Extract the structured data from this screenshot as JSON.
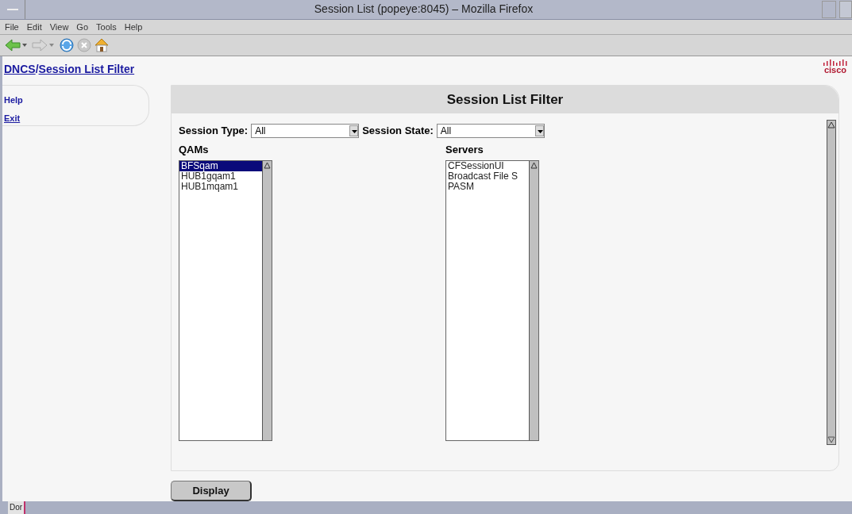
{
  "window": {
    "title": "Session List (popeye:8045) – Mozilla Firefox"
  },
  "menu": [
    "File",
    "Edit",
    "View",
    "Go",
    "Tools",
    "Help"
  ],
  "breadcrumb": [
    {
      "label": "DNCS"
    },
    {
      "label": "Session List Filter"
    }
  ],
  "breadcrumb_separator": "/",
  "logo": {
    "text": "cisco"
  },
  "sidebar": {
    "items": [
      {
        "label": "Help"
      },
      {
        "label": "Exit"
      }
    ]
  },
  "panel": {
    "title": "Session List Filter",
    "session_type": {
      "label": "Session Type:",
      "value": "All"
    },
    "session_state": {
      "label": "Session State:",
      "value": "All"
    },
    "qams": {
      "label": "QAMs",
      "items": [
        {
          "label": "BFSqam",
          "selected": true
        },
        {
          "label": "HUB1gqam1",
          "selected": false
        },
        {
          "label": "HUB1mqam1",
          "selected": false
        }
      ]
    },
    "servers": {
      "label": "Servers",
      "items": [
        {
          "label": "CFSessionUI",
          "selected": false
        },
        {
          "label": "Broadcast File S",
          "selected": false
        },
        {
          "label": "PASM",
          "selected": false
        }
      ]
    }
  },
  "display_button": "Display",
  "status_bar": {
    "text": "Dor"
  }
}
